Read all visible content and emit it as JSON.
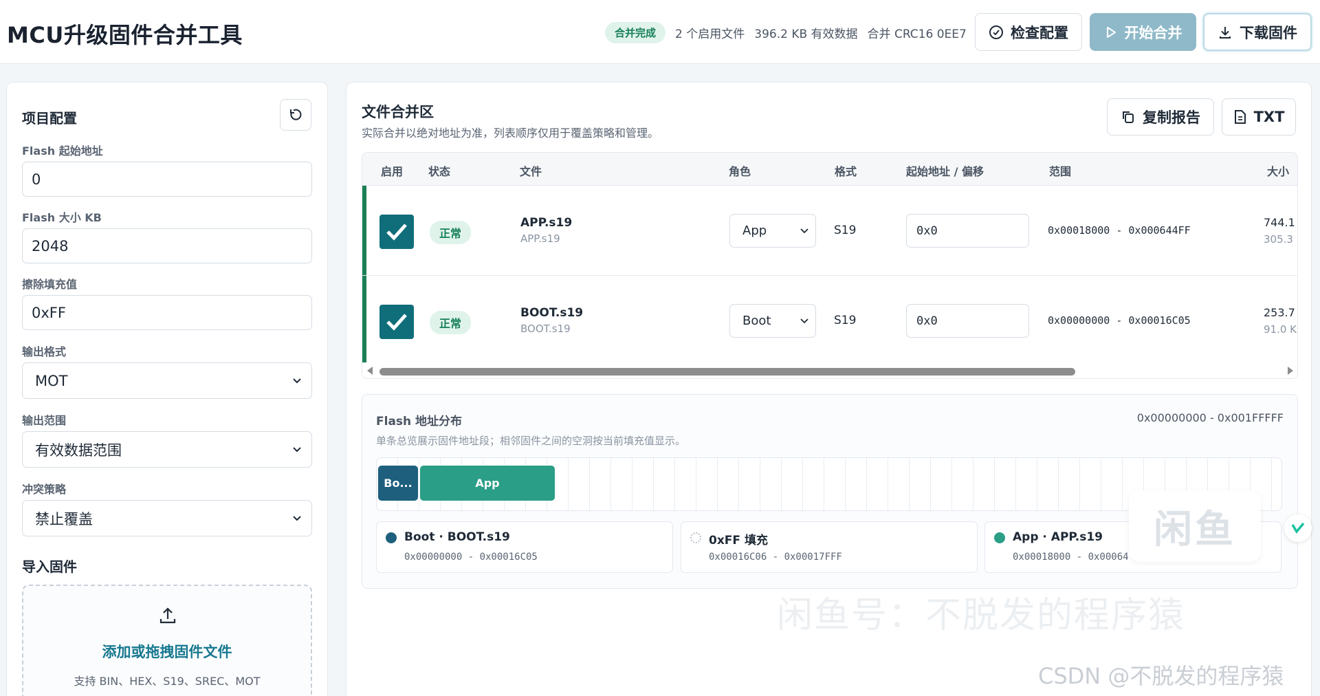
{
  "header": {
    "title": "MCU升级固件合并工具",
    "status_badge": "合并完成",
    "status_files": "2 个启用文件",
    "status_size": "396.2 KB 有效数据",
    "status_crc": "合并 CRC16 0EE7",
    "btn_check": "检查配置",
    "btn_merge": "开始合并",
    "btn_download": "下载固件"
  },
  "left": {
    "title": "项目配置",
    "flash_start_label": "Flash 起始地址",
    "flash_start_value": "0",
    "flash_size_label": "Flash 大小 KB",
    "flash_size_value": "2048",
    "erase_fill_label": "擦除填充值",
    "erase_fill_value": "0xFF",
    "output_format_label": "输出格式",
    "output_format_value": "MOT",
    "output_range_label": "输出范围",
    "output_range_value": "有效数据范围",
    "conflict_label": "冲突策略",
    "conflict_value": "禁止覆盖",
    "import_title": "导入固件",
    "drop_main": "添加或拖拽固件文件",
    "drop_sub": "支持 BIN、HEX、S19、SREC、MOT"
  },
  "merge": {
    "title": "文件合并区",
    "subtitle": "实际合并以绝对地址为准，列表顺序仅用于覆盖策略和管理。",
    "btn_copy": "复制报告",
    "btn_txt": "TXT",
    "columns": {
      "enable": "启用",
      "status": "状态",
      "file": "文件",
      "role": "角色",
      "format": "格式",
      "start": "起始地址 / 偏移",
      "range": "范围",
      "size": "大小"
    },
    "rows": [
      {
        "status": "正常",
        "name": "APP.s19",
        "subname": "APP.s19",
        "role": "App",
        "format": "S19",
        "offset": "0x0",
        "range": "0x00018000 - 0x000644FF",
        "size": "744.1",
        "size2": "305.3"
      },
      {
        "status": "正常",
        "name": "BOOT.s19",
        "subname": "BOOT.s19",
        "role": "Boot",
        "format": "S19",
        "offset": "0x0",
        "range": "0x00000000 - 0x00016C05",
        "size": "253.7",
        "size2": "91.0 K"
      }
    ]
  },
  "flash": {
    "title": "Flash 地址分布",
    "range": "0x00000000 - 0x001FFFFF",
    "subtitle": "单条总览展示固件地址段；相邻固件之间的空洞按当前填充值显示。",
    "seg_boot": "Bo...",
    "seg_app": "App",
    "legend": [
      {
        "title": "Boot · BOOT.s19",
        "range": "0x00000000 - 0x00016C05",
        "color": "#1d5f7d"
      },
      {
        "title": "0xFF 填充",
        "range": "0x00016C06 - 0x00017FFF",
        "color": "#cfd6dd"
      },
      {
        "title": "App · APP.s19",
        "range": "0x00018000 - 0x00064",
        "color": "#2a9e86"
      }
    ]
  },
  "watermarks": {
    "logo": "闲鱼",
    "line1": "闲鱼号：不脱发的程序猿",
    "line2": "CSDN @不脱发的程序猿"
  }
}
